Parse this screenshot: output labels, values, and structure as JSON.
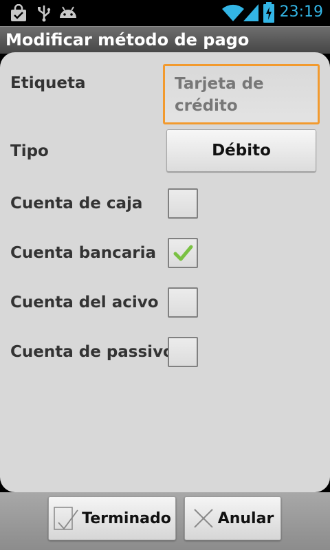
{
  "status_bar": {
    "time": "23:19",
    "icons": [
      "shopping-bag-icon",
      "usb-icon",
      "android-icon",
      "wifi-icon",
      "signal-icon",
      "battery-charging-icon"
    ],
    "accent_color": "#33b5e5"
  },
  "title_bar": {
    "title": "Modificar método de pago"
  },
  "form": {
    "label_field": {
      "label": "Etiqueta",
      "value": "Tarjeta de crédito"
    },
    "type_field": {
      "label": "Tipo",
      "selected": "Débito"
    },
    "checkboxes": [
      {
        "label": "Cuenta de caja",
        "checked": false
      },
      {
        "label": "Cuenta bancaria",
        "checked": true
      },
      {
        "label": "Cuenta del acivo",
        "checked": false
      },
      {
        "label": "Cuenta de passivo",
        "checked": false
      }
    ]
  },
  "buttons": {
    "done": {
      "label": "Terminado",
      "icon": "checkmark-icon"
    },
    "cancel": {
      "label": "Anular",
      "icon": "close-icon"
    }
  },
  "colors": {
    "focus_border": "#f29a2e",
    "check_green": "#7ac143"
  }
}
